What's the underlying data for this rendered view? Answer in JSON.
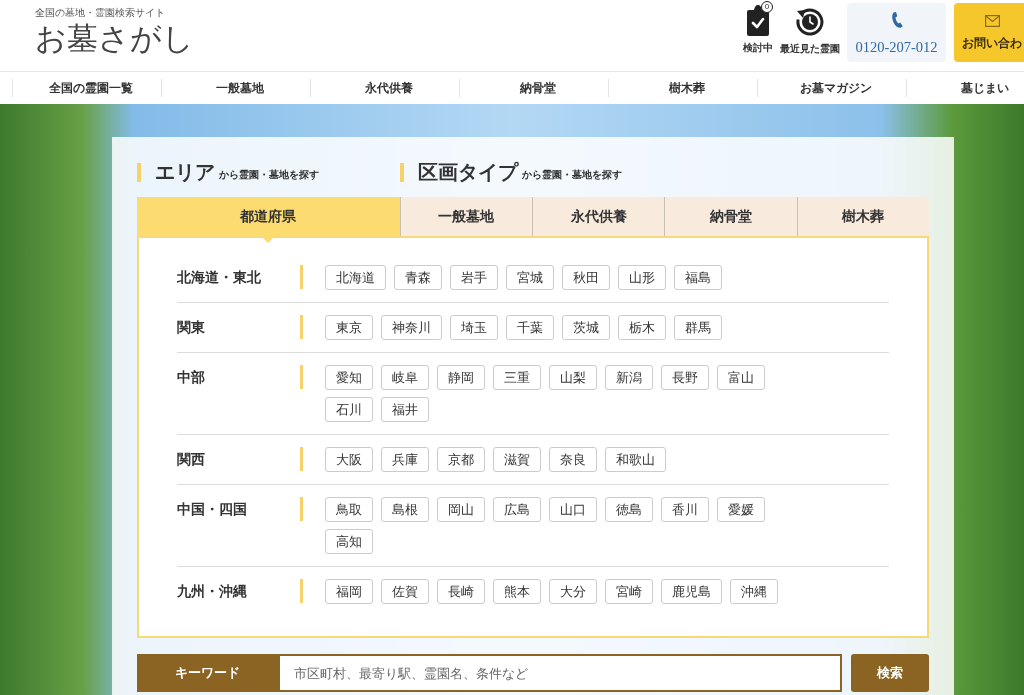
{
  "header": {
    "tagline": "全国の墓地・霊園検索サイト",
    "logo": "お墓さがし",
    "shortlist": {
      "label": "検討中",
      "count": "0"
    },
    "recent": {
      "label": "最近見た霊園"
    },
    "phone": "0120-207-012",
    "contact": "お問い合わ"
  },
  "nav": [
    "全国の霊園一覧",
    "一般墓地",
    "永代供養",
    "納骨堂",
    "樹木葬",
    "お墓マガジン",
    "墓じまい"
  ],
  "search": {
    "headings": [
      {
        "title": "エリア",
        "subtitle": "から霊園・墓地を探す"
      },
      {
        "title": "区画タイプ",
        "subtitle": "から霊園・墓地を探す"
      }
    ],
    "tabs": [
      {
        "label": "都道府県",
        "selected": true
      },
      {
        "label": "一般墓地",
        "selected": false
      },
      {
        "label": "永代供養",
        "selected": false
      },
      {
        "label": "納骨堂",
        "selected": false
      },
      {
        "label": "樹木葬",
        "selected": false
      }
    ],
    "regions": [
      {
        "name": "北海道・東北",
        "prefectures": [
          "北海道",
          "青森",
          "岩手",
          "宮城",
          "秋田",
          "山形",
          "福島"
        ]
      },
      {
        "name": "関東",
        "prefectures": [
          "東京",
          "神奈川",
          "埼玉",
          "千葉",
          "茨城",
          "栃木",
          "群馬"
        ]
      },
      {
        "name": "中部",
        "prefectures": [
          "愛知",
          "岐阜",
          "静岡",
          "三重",
          "山梨",
          "新潟",
          "長野",
          "富山",
          "石川",
          "福井"
        ]
      },
      {
        "name": "関西",
        "prefectures": [
          "大阪",
          "兵庫",
          "京都",
          "滋賀",
          "奈良",
          "和歌山"
        ]
      },
      {
        "name": "中国・四国",
        "prefectures": [
          "鳥取",
          "島根",
          "岡山",
          "広島",
          "山口",
          "徳島",
          "香川",
          "愛媛",
          "高知"
        ]
      },
      {
        "name": "九州・沖縄",
        "prefectures": [
          "福岡",
          "佐賀",
          "長崎",
          "熊本",
          "大分",
          "宮崎",
          "鹿児島",
          "沖縄"
        ]
      }
    ],
    "keyword": {
      "label": "キーワード",
      "placeholder": "市区町村、最寄り駅、霊園名、条件など",
      "button": "検索"
    }
  }
}
